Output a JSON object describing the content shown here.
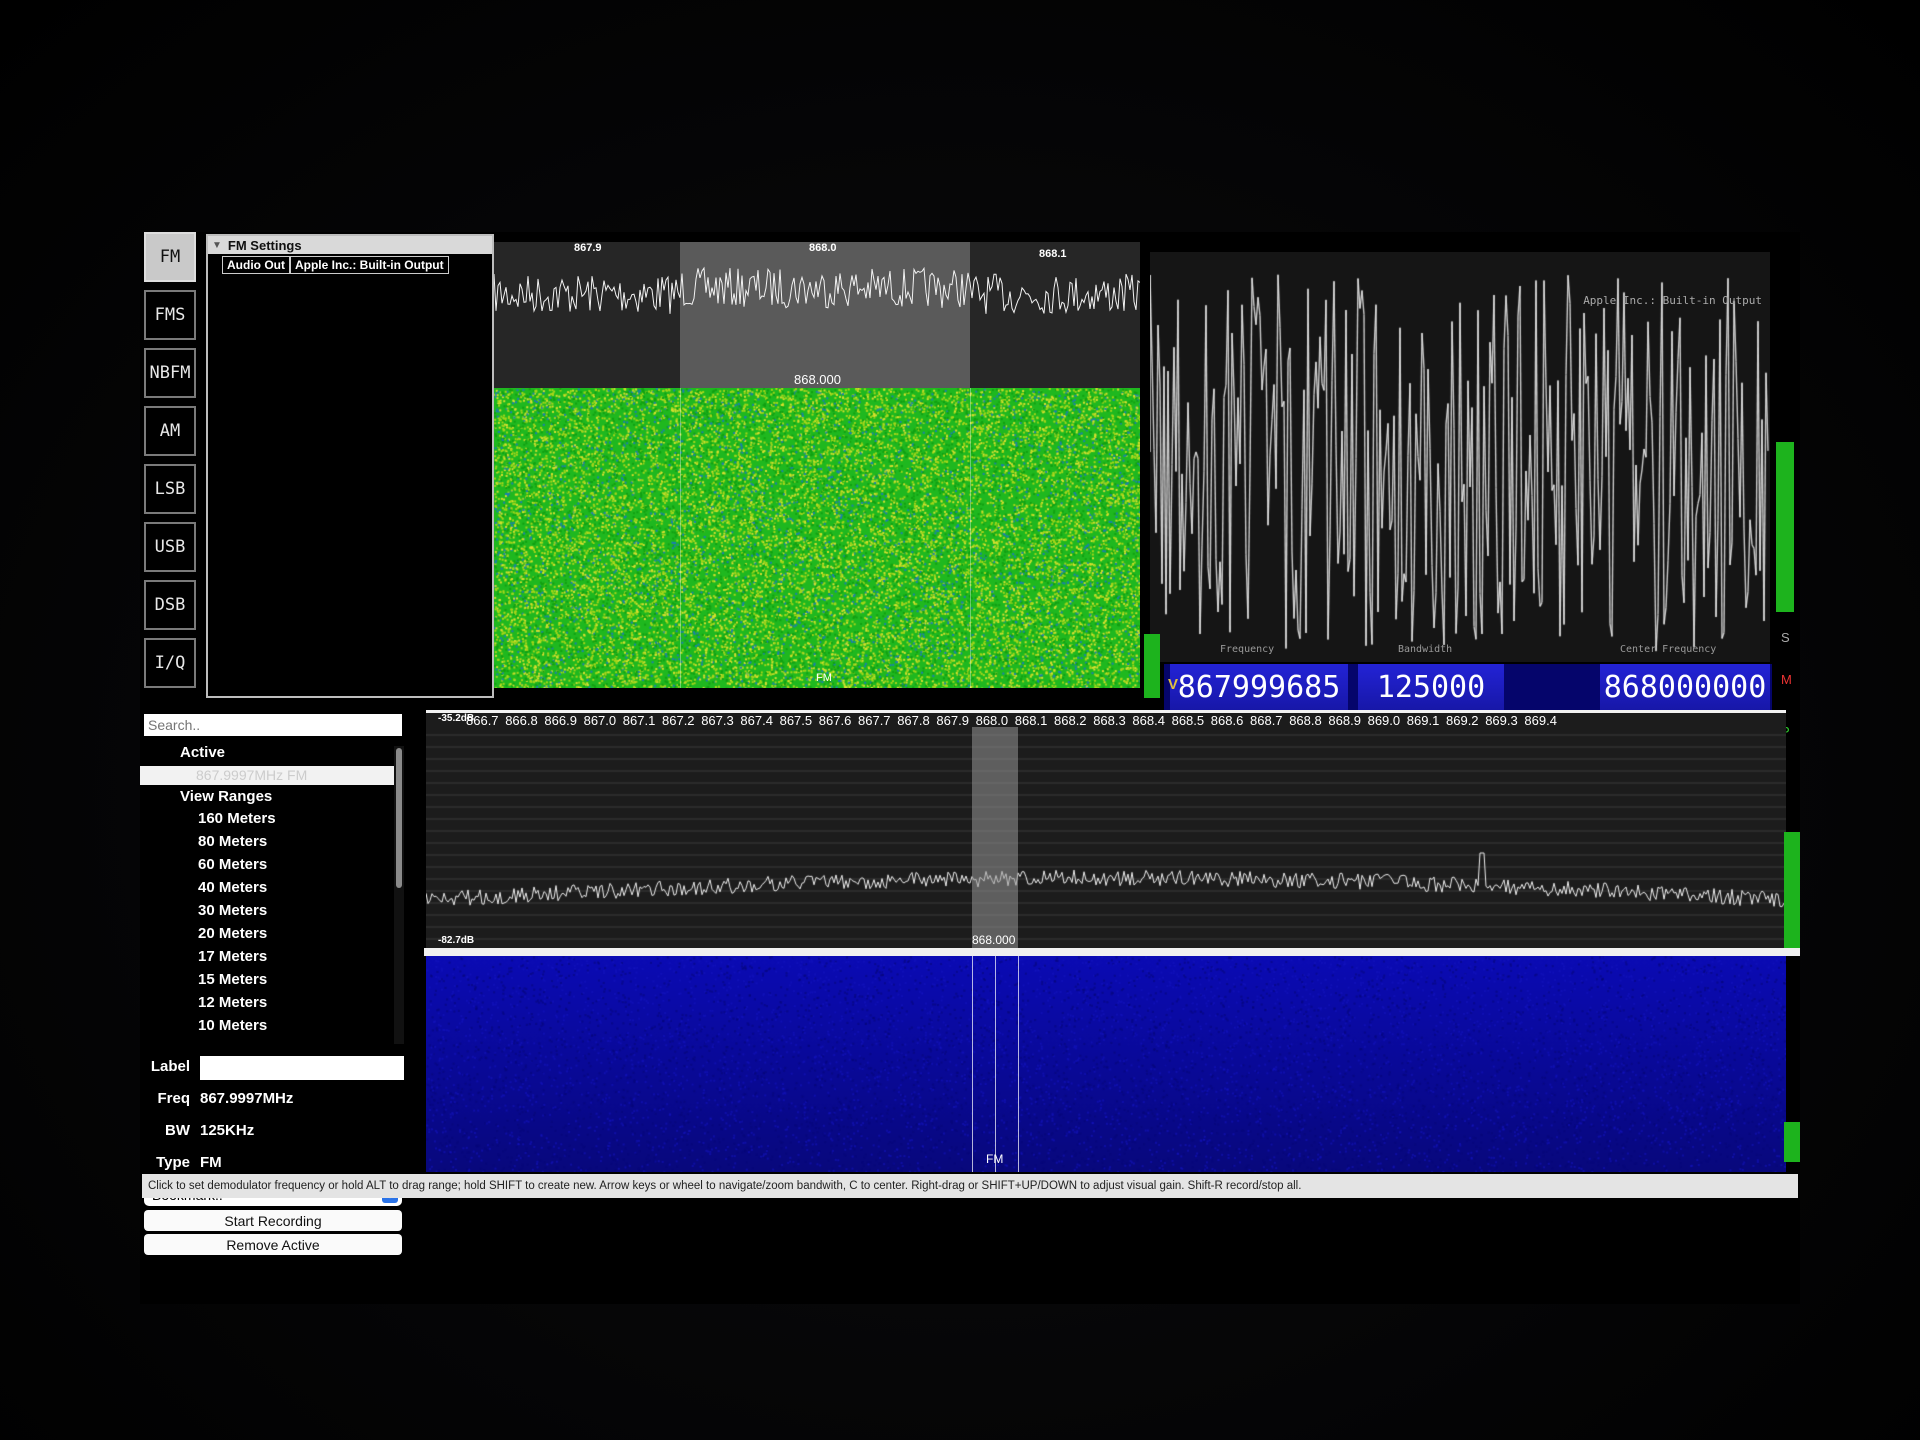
{
  "demodulators": [
    {
      "label": "FM",
      "active": true
    },
    {
      "label": "FMS",
      "active": false
    },
    {
      "label": "NBFM",
      "active": false
    },
    {
      "label": "AM",
      "active": false
    },
    {
      "label": "LSB",
      "active": false
    },
    {
      "label": "USB",
      "active": false
    },
    {
      "label": "DSB",
      "active": false
    },
    {
      "label": "I/Q",
      "active": false
    }
  ],
  "settings": {
    "title": "FM Settings",
    "audio_out_label": "Audio Out",
    "audio_out_value": "Apple Inc.: Built-in Output"
  },
  "top_spectrum": {
    "ticks": [
      "867.9",
      "868.0",
      "868.1"
    ],
    "center_label": "868.000",
    "mode_label": "FM"
  },
  "scope": {
    "caption": "Apple Inc.: Built-in Output"
  },
  "readouts": {
    "v_label": "V",
    "frequency": {
      "caption": "Frequency",
      "value": "867999685"
    },
    "bandwidth": {
      "caption": "Bandwidth",
      "value": "125000"
    },
    "center": {
      "caption": "Center Frequency",
      "value": "868000000"
    },
    "s_label": "S",
    "m_label": "M",
    "p_label": "P"
  },
  "bookmarks": {
    "search_placeholder": "Search..",
    "active_header": "Active",
    "active_item": "867.9997MHz FM",
    "view_ranges_header": "View Ranges",
    "ranges": [
      "160 Meters",
      "80 Meters",
      "60 Meters",
      "40 Meters",
      "30 Meters",
      "20 Meters",
      "17 Meters",
      "15 Meters",
      "12 Meters",
      "10 Meters"
    ],
    "label_label": "Label",
    "freq_label": "Freq",
    "freq_value": "867.9997MHz",
    "bw_label": "BW",
    "bw_value": "125KHz",
    "type_label": "Type",
    "type_value": "FM",
    "bookmark_select": "Bookmark..",
    "start_recording": "Start Recording",
    "remove_active": "Remove Active"
  },
  "main_spectrum": {
    "db_top": "-35.2dB",
    "db_bottom": "-82.7dB",
    "ticks": [
      "866.7",
      "866.8",
      "866.9",
      "867.0",
      "867.1",
      "867.2",
      "867.3",
      "867.4",
      "867.5",
      "867.6",
      "867.7",
      "867.8",
      "867.9",
      "868.0",
      "868.1",
      "868.2",
      "868.3",
      "868.4",
      "868.5",
      "868.6",
      "868.7",
      "868.8",
      "868.9",
      "869.0",
      "869.1",
      "869.2",
      "869.3",
      "869.4"
    ],
    "center_label": "868.000",
    "mode_label": "FM"
  },
  "status": "Click to set demodulator frequency or hold ALT to drag range; hold SHIFT to create new. Arrow keys or wheel to navigate/zoom bandwith, C to center. Right-drag or SHIFT+UP/DOWN to adjust visual gain. Shift-R record/stop all.",
  "colors": {
    "waterfall_top": "#22c422",
    "waterfall_main": "#0a0ab0",
    "meter": "#1db31d",
    "readout_bg": "#1d1dbf"
  }
}
